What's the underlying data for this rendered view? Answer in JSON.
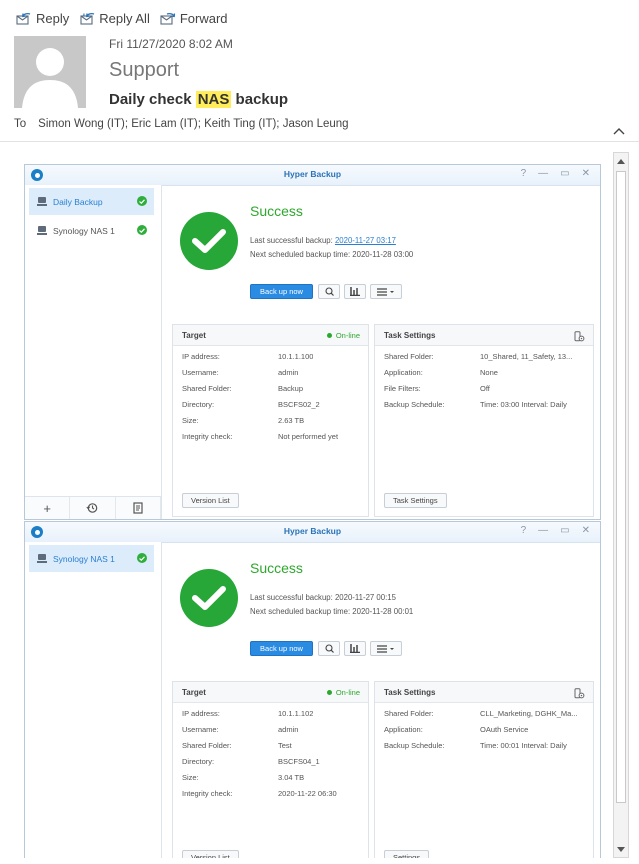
{
  "toolbar": {
    "reply": "Reply",
    "reply_all": "Reply All",
    "forward": "Forward"
  },
  "email": {
    "date": "Fri 11/27/2020 8:02 AM",
    "sender": "Support",
    "subject_before": "Daily check ",
    "subject_highlight": "NAS",
    "subject_after": " backup",
    "to_label": "To",
    "recipients": "Simon Wong (IT); Eric Lam (IT); Keith Ting (IT); Jason Leung"
  },
  "colors": {
    "success": "#2ea72e",
    "accent": "#2a8be3",
    "highlight": "#ffee59"
  },
  "windows": [
    {
      "title": "Hyper Backup",
      "controls": [
        "?",
        "—",
        "▭",
        "✕"
      ],
      "sidebar": [
        "Daily Backup",
        "Synology NAS 1"
      ],
      "status": "Success",
      "last_label": "Last successful backup: ",
      "last_value": "2020-11-27 03:17",
      "next_label": "Next scheduled backup time: ",
      "next_value": "2020-11-28 03:00",
      "backup_button": "Back up now",
      "target": {
        "title": "Target",
        "state": "On-line",
        "rows": [
          {
            "k": "IP address:",
            "v": "10.1.1.100"
          },
          {
            "k": "Username:",
            "v": "admin"
          },
          {
            "k": "Shared Folder:",
            "v": "Backup"
          },
          {
            "k": "Directory:",
            "v": "BSCFS02_2"
          },
          {
            "k": "Size:",
            "v": "2.63 TB"
          },
          {
            "k": "Integrity check:",
            "v": "Not performed yet"
          }
        ],
        "button": "Version List"
      },
      "task": {
        "title": "Task Settings",
        "rows": [
          {
            "k": "Shared Folder:",
            "v": "10_Shared, 11_Safety, 13..."
          },
          {
            "k": "Application:",
            "v": "None"
          },
          {
            "k": "File Filters:",
            "v": "Off"
          },
          {
            "k": "Backup Schedule:",
            "v": "Time: 03:00 Interval: Daily"
          }
        ],
        "button": "Task Settings"
      }
    },
    {
      "title": "Hyper Backup",
      "controls": [
        "?",
        "—",
        "▭",
        "✕"
      ],
      "sidebar": [
        "Synology NAS 1"
      ],
      "status": "Success",
      "last_label": "Last successful backup: ",
      "last_value": "2020-11-27 00:15",
      "next_label": "Next scheduled backup time: ",
      "next_value": "2020-11-28 00:01",
      "backup_button": "Back up now",
      "target": {
        "title": "Target",
        "state": "On-line",
        "rows": [
          {
            "k": "IP address:",
            "v": "10.1.1.102"
          },
          {
            "k": "Username:",
            "v": "admin"
          },
          {
            "k": "Shared Folder:",
            "v": "Test"
          },
          {
            "k": "Directory:",
            "v": "BSCFS04_1"
          },
          {
            "k": "Size:",
            "v": "3.04 TB"
          },
          {
            "k": "Integrity check:",
            "v": "2020-11-22 06:30"
          }
        ],
        "button": "Version List"
      },
      "task": {
        "title": "Task Settings",
        "rows": [
          {
            "k": "Shared Folder:",
            "v": "CLL_Marketing, DGHK_Ma..."
          },
          {
            "k": "Application:",
            "v": "OAuth Service"
          },
          {
            "k": "Backup Schedule:",
            "v": "Time: 00:01 Interval: Daily"
          }
        ],
        "button": "Settings"
      }
    }
  ]
}
